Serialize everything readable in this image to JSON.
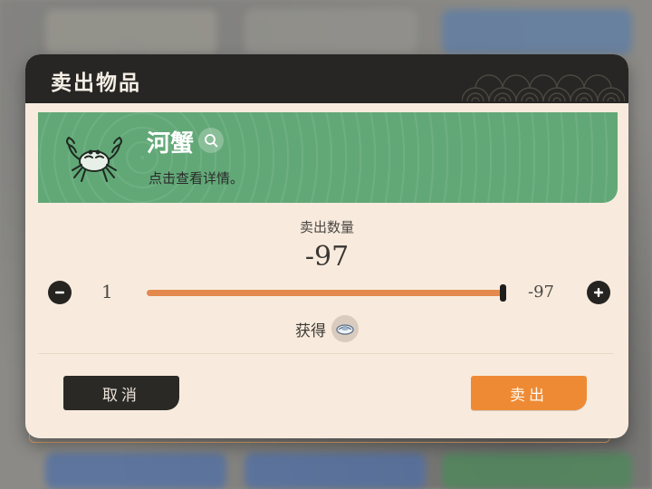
{
  "dialog": {
    "title": "卖出物品"
  },
  "item": {
    "name": "河蟹",
    "description": "点击查看详情。",
    "icon": "crab-icon"
  },
  "quantity": {
    "label": "卖出数量",
    "value": "-97",
    "min_label": "1",
    "max_label": "-97",
    "slider_fraction": 1.0
  },
  "reward": {
    "label": "获得",
    "icon": "coin-icon"
  },
  "buttons": {
    "cancel_label": "取消",
    "sell_label": "卖出"
  },
  "colors": {
    "titlebar": "#272624",
    "panel": "#f8ebde",
    "banner_green": "#62a877",
    "accent_orange": "#ef8a34",
    "slider_fill": "#e4894d",
    "dark_button": "#2a2926"
  }
}
